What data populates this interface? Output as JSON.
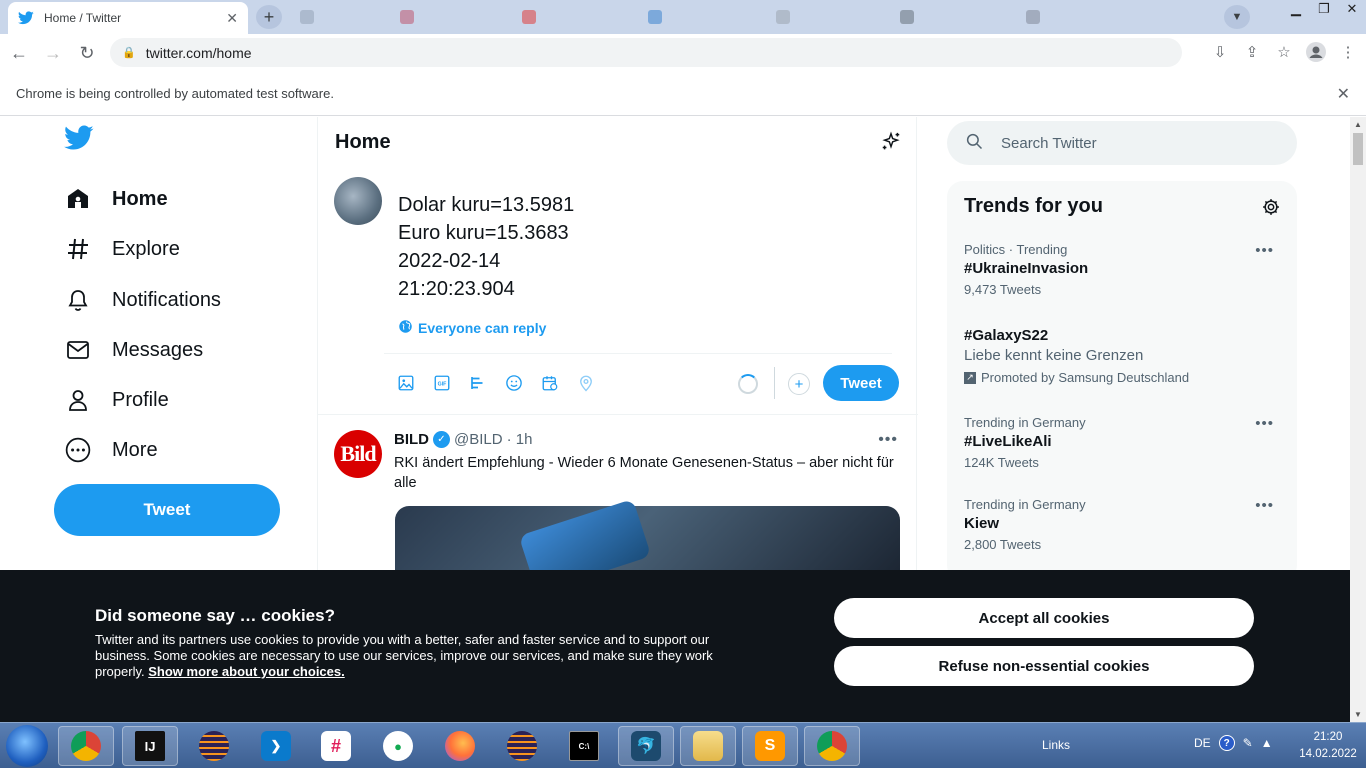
{
  "browser": {
    "active_tab_title": "Home / Twitter",
    "url": "twitter.com/home",
    "infobar_text": "Chrome is being controlled by automated test software."
  },
  "sidebar": {
    "items": [
      {
        "label": "Home",
        "icon": "home-icon"
      },
      {
        "label": "Explore",
        "icon": "hashtag-icon"
      },
      {
        "label": "Notifications",
        "icon": "bell-icon"
      },
      {
        "label": "Messages",
        "icon": "mail-icon"
      },
      {
        "label": "Profile",
        "icon": "person-icon"
      },
      {
        "label": "More",
        "icon": "more-circle-icon"
      }
    ],
    "tweet_button": "Tweet"
  },
  "timeline": {
    "title": "Home",
    "compose": {
      "text": "Dolar kuru=13.5981\nEuro kuru=15.3683\n2022-02-14\n21:20:23.904",
      "reply_setting": "Everyone can reply",
      "tweet_button": "Tweet"
    },
    "tweet": {
      "author": "BILD",
      "handle": "@BILD",
      "time": "· 1h",
      "avatar_text": "Bild",
      "text": "RKI ändert Empfehlung - Wieder 6 Monate Genesenen-Status – aber nicht für alle"
    }
  },
  "right": {
    "search_placeholder": "Search Twitter",
    "trends_title": "Trends for you",
    "trends": [
      {
        "meta": "Politics · Trending",
        "name": "#UkraineInvasion",
        "count": "9,473 Tweets"
      },
      {
        "name": "#GalaxyS22",
        "description": "Liebe kennt keine Grenzen",
        "promoted": "Promoted by Samsung Deutschland"
      },
      {
        "meta": "Trending in Germany",
        "name": "#LiveLikeAli",
        "count": "124K Tweets"
      },
      {
        "meta": "Trending in Germany",
        "name": "Kiew",
        "count": "2,800 Tweets"
      }
    ]
  },
  "cookie_banner": {
    "title": "Did someone say … cookies?",
    "text": "Twitter and its partners use cookies to provide you with a better, safer and faster service and to support our business. Some cookies are necessary to use our services, improve our services, and make sure they work properly.",
    "link": "Show more about your choices.",
    "accept": "Accept all cookies",
    "refuse": "Refuse non-essential cookies"
  },
  "taskbar": {
    "links_label": "Links",
    "language": "DE",
    "time": "21:20",
    "date": "14.02.2022"
  },
  "colors": {
    "accent": "#1d9bf0",
    "cookie_bg": "#0f1419",
    "bild_red": "#d90000"
  }
}
